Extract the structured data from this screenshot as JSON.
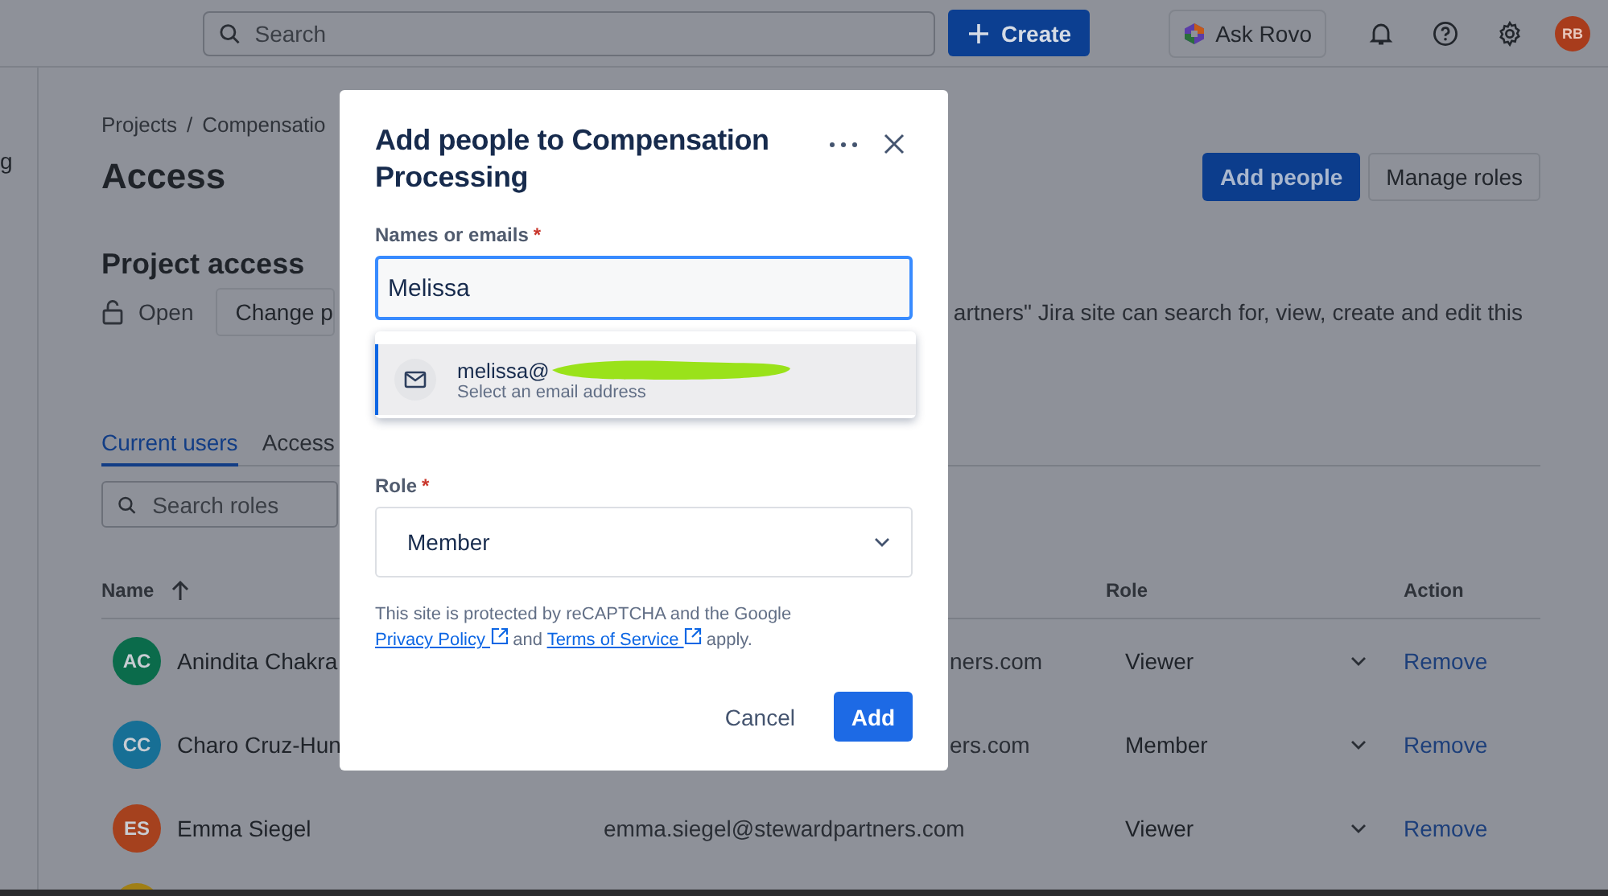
{
  "topbar": {
    "search_placeholder": "Search",
    "create": "Create",
    "ask": "Ask Rovo",
    "avatar": "RB"
  },
  "sidebar": {
    "fragment": "g"
  },
  "breadcrumb": {
    "root": "Projects",
    "separator": "/",
    "current": "Compensatio"
  },
  "title": "Access",
  "actions": [
    "Add people",
    "Manage roles"
  ],
  "project_access": {
    "heading": "Project access",
    "status": "Open",
    "change_button": "Change p",
    "description": "artners\" Jira site can search for, view, create and edit this"
  },
  "tabs": [
    {
      "label": "Current users",
      "selected": true
    },
    {
      "label": "Access",
      "selected": false
    }
  ],
  "roles_search": {
    "placeholder": "Search roles"
  },
  "table": {
    "columns": [
      "Name",
      "Role",
      "Action"
    ],
    "rows": [
      {
        "initials": "AC",
        "color": "#0b6b4b",
        "name": "Anindita Chakra",
        "email": "ners.com",
        "clipped": true,
        "role": "Viewer",
        "action": "Remove"
      },
      {
        "initials": "CC",
        "color": "#176f95",
        "name": "Charo Cruz-Hun",
        "email": "ers.com",
        "clipped": true,
        "role": "Member",
        "action": "Remove"
      },
      {
        "initials": "ES",
        "color": "#a5411e",
        "name": "Emma Siegel",
        "email": "emma.siegel@stewardpartners.com",
        "clipped": false,
        "role": "Viewer",
        "action": "Remove"
      }
    ]
  },
  "dialog": {
    "title": "Add people to Compensation Processing",
    "names_label": "Names or emails",
    "required_mark": "*",
    "names_value": "Melissa",
    "suggestion": {
      "email": "melissa@",
      "hint": "Select an email address",
      "selected": true
    },
    "role_label": "Role",
    "role_value": "Member",
    "notice": {
      "before": "This site is protected by reCAPTCHA and the Google ",
      "link1": "Privacy Policy",
      "middle": " and ",
      "link2": "Terms of Service",
      "after": " apply."
    },
    "cancel": "Cancel",
    "submit": "Add"
  }
}
